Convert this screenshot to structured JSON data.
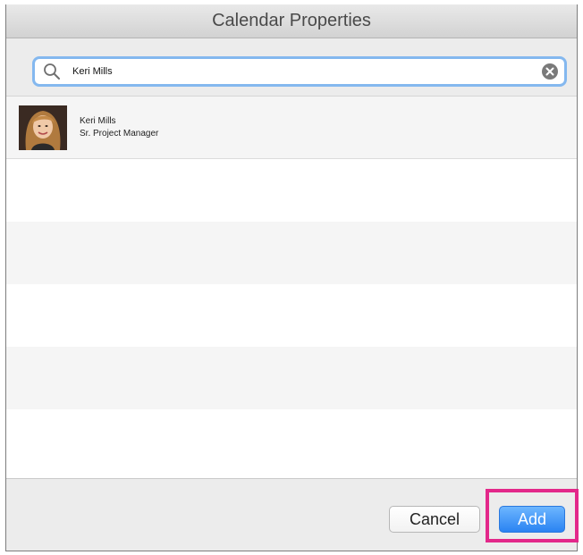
{
  "window": {
    "title": "Calendar Properties"
  },
  "search": {
    "value": "Keri Mills",
    "icon": "search-icon",
    "clear_icon": "clear-icon"
  },
  "results": [
    {
      "name": "Keri Mills",
      "title": "Sr. Project Manager",
      "avatar": "avatar"
    }
  ],
  "footer": {
    "cancel_label": "Cancel",
    "add_label": "Add"
  },
  "colors": {
    "accent_blue": "#2a83f2",
    "focus_ring": "#84b8ef",
    "highlight": "#e3288a"
  }
}
